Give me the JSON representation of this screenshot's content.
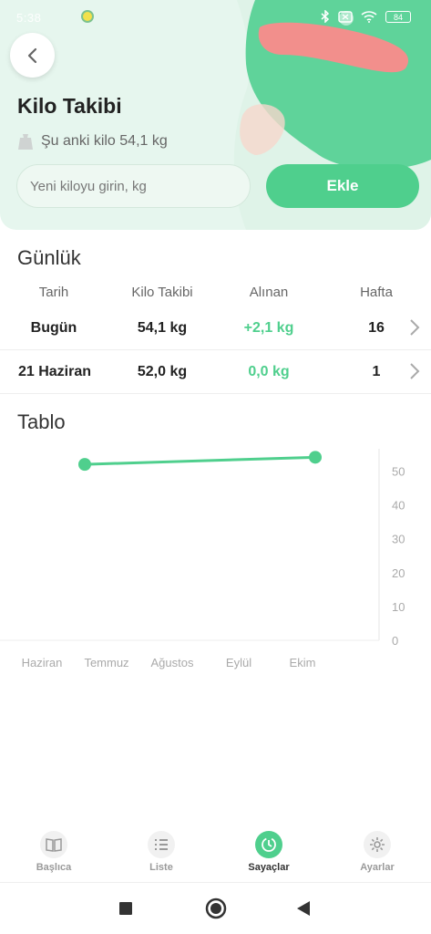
{
  "status_bar": {
    "time": "5:38",
    "battery": "84"
  },
  "header": {
    "title": "Kilo Takibi",
    "current_weight": "Şu anki kilo 54,1 kg",
    "input_placeholder": "Yeni kiloyu girin, kg",
    "add_label": "Ekle"
  },
  "daily": {
    "title": "Günlük",
    "columns": [
      "Tarih",
      "Kilo Takibi",
      "Alınan",
      "Hafta"
    ],
    "rows": [
      {
        "date": "Bugün",
        "weight": "54,1 kg",
        "gained": "+2,1 kg",
        "week": "16"
      },
      {
        "date": "21 Haziran",
        "weight": "52,0 kg",
        "gained": "0,0 kg",
        "week": "1"
      }
    ]
  },
  "chart_title": "Tablo",
  "chart_data": {
    "type": "line",
    "categories": [
      "Haziran",
      "Temmuz",
      "Ağustos",
      "Eylül",
      "Ekim"
    ],
    "y_ticks": [
      "50",
      "40",
      "30",
      "20",
      "10",
      "0"
    ],
    "ylim": [
      0,
      55
    ],
    "series": [
      {
        "points": [
          {
            "x": "Temmuz",
            "y": 52.0
          },
          {
            "x": "Ekim",
            "y": 54.1
          }
        ]
      }
    ],
    "color": "#4fcf8d",
    "grid": false
  },
  "nav": [
    {
      "label": "Başlıca",
      "icon": "book-icon",
      "active": false
    },
    {
      "label": "Liste",
      "icon": "list-icon",
      "active": false
    },
    {
      "label": "Sayaçlar",
      "icon": "timer-icon",
      "active": true
    },
    {
      "label": "Ayarlar",
      "icon": "gear-icon",
      "active": false
    }
  ],
  "colors": {
    "accent": "#4fcf8d",
    "header_bg": "#e6f6ee"
  }
}
